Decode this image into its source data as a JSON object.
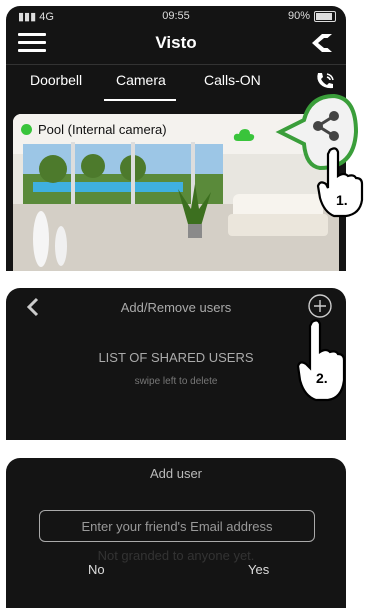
{
  "screen1": {
    "status": {
      "signal": "4G",
      "time": "09:55",
      "battery": "90%"
    },
    "title": "Visto",
    "tabs": [
      {
        "label": "Doorbell"
      },
      {
        "label": "Camera"
      },
      {
        "label": "Calls-ON"
      }
    ],
    "camera_label": "Pool (Internal camera)",
    "status_dot_color": "#39c43b",
    "cloud_color": "#39c43b",
    "step": "1."
  },
  "screen2": {
    "title": "Add/Remove users",
    "list_title": "LIST OF SHARED USERS",
    "hint": "swipe left to delete",
    "step": "2."
  },
  "screen3": {
    "title": "Add user",
    "email_placeholder": "Enter your friend's Email address",
    "background_text": "Not granded to anyone yet.",
    "no_label": "No",
    "yes_label": "Yes"
  },
  "colors": {
    "accent_green": "#3a9e3a",
    "dark_bg": "#141414"
  }
}
